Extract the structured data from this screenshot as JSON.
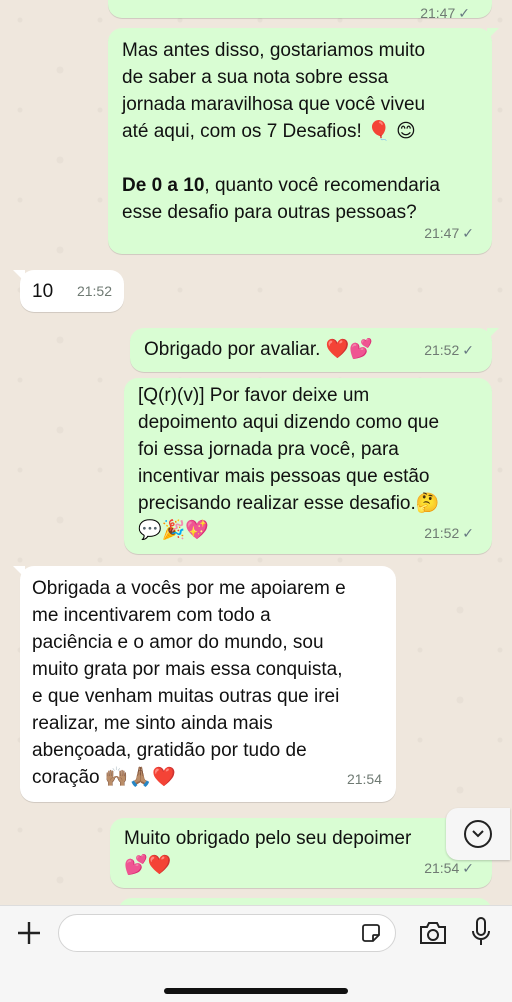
{
  "messages": [
    {
      "id": "m0",
      "from": "out",
      "top_partial_time": "21:47"
    },
    {
      "id": "m1",
      "from": "out",
      "lines": [
        "Mas antes disso, gostariamos muito",
        "de saber a sua nota sobre essa",
        "jornada maravilhosa que você viveu",
        "até aqui, com os 7 Desafios! 🎈 😊"
      ],
      "lines2_bold": "De 0 a 10",
      "lines2": [
        ", quanto você recomendaria",
        "esse desafio para outras pessoas?"
      ],
      "time": "21:47"
    },
    {
      "id": "m2",
      "from": "in",
      "text": "10",
      "time": "21:52"
    },
    {
      "id": "m3",
      "from": "out",
      "text": "Obrigado por avaliar. ❤️💕",
      "time": "21:52"
    },
    {
      "id": "m4",
      "from": "out",
      "lines": [
        "[Q(r)(v)] Por favor deixe um",
        "depoimento aqui dizendo como que",
        "foi essa jornada pra você, para",
        "incentivar mais pessoas que estão",
        "precisando realizar esse desafio.🤔",
        "💬🎉💖"
      ],
      "time": "21:52"
    },
    {
      "id": "m5",
      "from": "in",
      "lines": [
        "Obrigada a vocês por me apoiarem e",
        "me incentivarem com todo a",
        "paciência e o amor do mundo, sou",
        "muito grata por mais essa conquista,",
        "e que venham muitas outras que irei",
        "realizar, me sinto ainda mais",
        "abençoada, gratidão por tudo de",
        "coração 🙌🏽🙏🏽❤️"
      ],
      "time": "21:54"
    },
    {
      "id": "m6",
      "from": "out",
      "lines": [
        "Muito obrigado pelo seu depoimer",
        "💕❤️"
      ],
      "time": "21:54"
    }
  ],
  "composer": {
    "placeholder": ""
  },
  "icons": [
    "plus-icon",
    "sticker-icon",
    "camera-icon",
    "microphone-icon",
    "scroll-down-icon"
  ]
}
